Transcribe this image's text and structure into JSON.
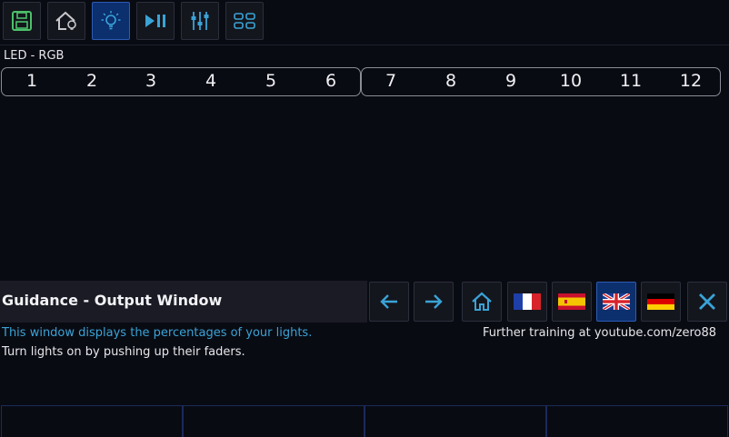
{
  "toolbar": {
    "buttons": [
      {
        "icon": "save-icon",
        "active": false
      },
      {
        "icon": "home-bulb-icon",
        "active": false
      },
      {
        "icon": "bulb-icon",
        "active": true
      },
      {
        "icon": "play-pause-icon",
        "active": false
      },
      {
        "icon": "faders-icon",
        "active": false
      },
      {
        "icon": "layout-icon",
        "active": false
      }
    ]
  },
  "fixture": {
    "label": "LED - RGB",
    "channels": [
      "1",
      "2",
      "3",
      "4",
      "5",
      "6",
      "7",
      "8",
      "9",
      "10",
      "11",
      "12"
    ]
  },
  "guidance": {
    "title": "Guidance - Output Window",
    "line1": "This window displays the percentages of your lights.",
    "line2": "Turn lights on by pushing up their faders.",
    "training": "Further training at youtube.com/zero88",
    "buttons": [
      "arrow-left-icon",
      "arrow-right-icon",
      "home-icon",
      "flag-france-icon",
      "flag-spain-icon",
      "flag-uk-icon",
      "flag-germany-icon",
      "close-icon"
    ],
    "active_language": "flag-uk-icon"
  },
  "colors": {
    "background": "#090b13",
    "accent": "#3aa3d6",
    "active": "#0c2f6e"
  }
}
